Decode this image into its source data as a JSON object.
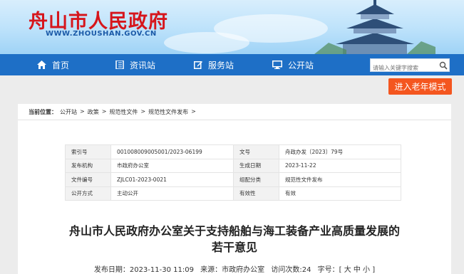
{
  "header": {
    "site_title": "舟山市人民政府",
    "site_url": "WWW.ZHOUSHAN.GOV.CN"
  },
  "nav": {
    "items": [
      {
        "label": "首页",
        "icon": "home-icon"
      },
      {
        "label": "资讯站",
        "icon": "book-icon"
      },
      {
        "label": "服务站",
        "icon": "edit-icon"
      },
      {
        "label": "公开站",
        "icon": "monitor-icon"
      }
    ],
    "search_placeholder": "请输入关键字搜索"
  },
  "elder_mode": "进入老年模式",
  "breadcrumb": {
    "label": "当前位置：",
    "items": [
      "公开站",
      "政策",
      "规范性文件",
      "规范性文件发布"
    ],
    "separator": ">"
  },
  "meta": {
    "rows": [
      {
        "k1": "索引号",
        "v1": "001008009005001/2023-06199",
        "k2": "文号",
        "v2": "舟政办发〔2023〕79号"
      },
      {
        "k1": "发布机构",
        "v1": "市政府办公室",
        "k2": "生成日期",
        "v2": "2023-11-22"
      },
      {
        "k1": "文件编号",
        "v1": "ZJLC01-2023-0021",
        "k2": "组配分类",
        "v2": "规范性文件发布"
      },
      {
        "k1": "公开方式",
        "v1": "主动公开",
        "k2": "有效性",
        "v2": "有效"
      }
    ]
  },
  "document": {
    "title_line1": "舟山市人民政府办公室关于支持船舶与海工装备产业高质量发展的",
    "title_line2": "若干意见",
    "publish_time": "发布日期：2023-11-30 11:09",
    "source": "来源：市政府办公室",
    "visits": "访问次数:24",
    "font_size": "字号：[ 大 中 小 ]"
  },
  "colors": {
    "nav_bg": "#1e6fc6",
    "title_red": "#d6161c",
    "elder_orange": "#f4561f"
  }
}
